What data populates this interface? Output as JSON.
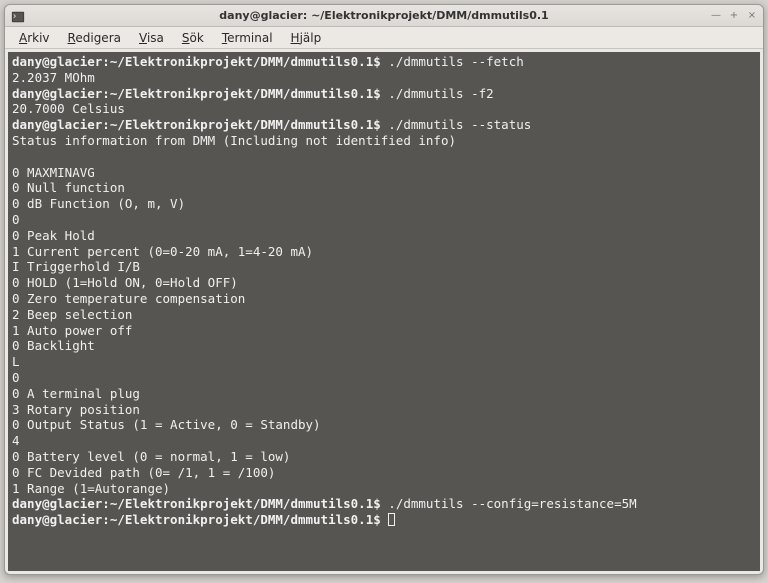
{
  "window": {
    "title": "dany@glacier: ~/Elektronikprojekt/DMM/dmmutils0.1"
  },
  "menu": {
    "arkiv": {
      "first": "A",
      "rest": "rkiv"
    },
    "redigera": {
      "first": "R",
      "rest": "edigera"
    },
    "visa": {
      "first": "V",
      "rest": "isa"
    },
    "sok": {
      "first": "S",
      "rest": "ök"
    },
    "terminal": {
      "first": "T",
      "rest": "erminal"
    },
    "hjalp": {
      "first": "H",
      "rest": "jälp"
    }
  },
  "term": {
    "prompt": "dany@glacier:~/Elektronikprojekt/DMM/dmmutils0.1$ ",
    "cmd1": "./dmmutils --fetch",
    "out1": "2.2037 MOhm",
    "cmd2": "./dmmutils -f2",
    "out2": "20.7000 Celsius",
    "cmd3": "./dmmutils --status",
    "out3a": "Status information from DMM (Including not identified info)",
    "blank": "",
    "s01": "0 MAXMINAVG",
    "s02": "0 Null function",
    "s03": "0 dB Function (O, m, V)",
    "s04": "0",
    "s05": "0 Peak Hold",
    "s06": "1 Current percent (0=0-20 mA, 1=4-20 mA)",
    "s07": "I Triggerhold I/B",
    "s08": "0 HOLD (1=Hold ON, 0=Hold OFF)",
    "s09": "0 Zero temperature compensation",
    "s10": "2 Beep selection",
    "s11": "1 Auto power off",
    "s12": "0 Backlight",
    "s13": "L",
    "s14": "0",
    "s15": "0 A terminal plug",
    "s16": "3 Rotary position",
    "s17": "0 Output Status (1 = Active, 0 = Standby)",
    "s18": "4",
    "s19": "0 Battery level (0 = normal, 1 = low)",
    "s20": "0 FC Devided path (0= /1, 1 = /100)",
    "s21": "1 Range (1=Autorange)",
    "cmd4": "./dmmutils --config=resistance=5M"
  }
}
